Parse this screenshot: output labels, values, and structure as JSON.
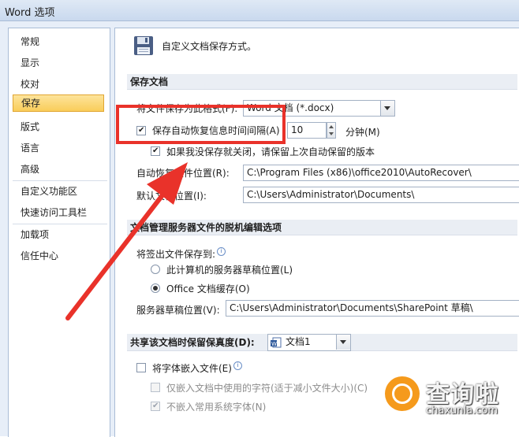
{
  "window": {
    "title": "Word 选项"
  },
  "sidebar": {
    "items": [
      {
        "label": "常规"
      },
      {
        "label": "显示"
      },
      {
        "label": "校对"
      },
      {
        "label": "保存"
      },
      {
        "label": "版式"
      },
      {
        "label": "语言"
      },
      {
        "label": "高级"
      },
      {
        "label": "自定义功能区"
      },
      {
        "label": "快速访问工具栏"
      },
      {
        "label": "加载项"
      },
      {
        "label": "信任中心"
      }
    ],
    "selected": "保存"
  },
  "main": {
    "header_text": "自定义文档保存方式。",
    "save_section": {
      "title": "保存文档",
      "format_label": "将文件保存为此格式(F):",
      "format_value": "Word 文档 (*.docx)",
      "autorecover_label": "保存自动恢复信息时间间隔(A)",
      "autorecover_checked": true,
      "autorecover_minutes": "10",
      "minutes_label": "分钟(M)",
      "keep_last_label": "如果我没保存就关闭，请保留上次自动保留的版本",
      "keep_last_checked": true,
      "autorecover_location_label": "自动恢复文件位置(R):",
      "autorecover_location_value": "C:\\Program Files (x86)\\office2010\\AutoRecover\\",
      "default_location_label": "默认文件位置(I):",
      "default_location_value": "C:\\Users\\Administrator\\Documents\\"
    },
    "offline_section": {
      "title": "文档管理服务器文件的脱机编辑选项",
      "checkout_label": "将签出文件保存到:",
      "option_server_drafts": "此计算机的服务器草稿位置(L)",
      "option_office_cache": "Office 文档缓存(O)",
      "selected_option": "Office 文档缓存(O)",
      "server_drafts_label": "服务器草稿位置(V):",
      "server_drafts_value": "C:\\Users\\Administrator\\Documents\\SharePoint 草稿\\"
    },
    "fidelity_section": {
      "title": "共享该文档时保留保真度(D):",
      "document_value": "文档1",
      "embed_fonts_label": "将字体嵌入文件(E)",
      "embed_fonts_checked": false,
      "embed_used_chars_label": "仅嵌入文档中使用的字符(适于减小文件大小)(C)",
      "embed_used_chars_checked": false,
      "no_common_fonts_label": "不嵌入常用系统字体(N)",
      "no_common_fonts_checked": true
    }
  },
  "watermark": {
    "text": "查询啦",
    "url": "chaxunla.com"
  },
  "colors": {
    "highlight": "#e9322a",
    "selected_nav": "#f9cd5a",
    "watermark_orange": "#f59a1c"
  }
}
